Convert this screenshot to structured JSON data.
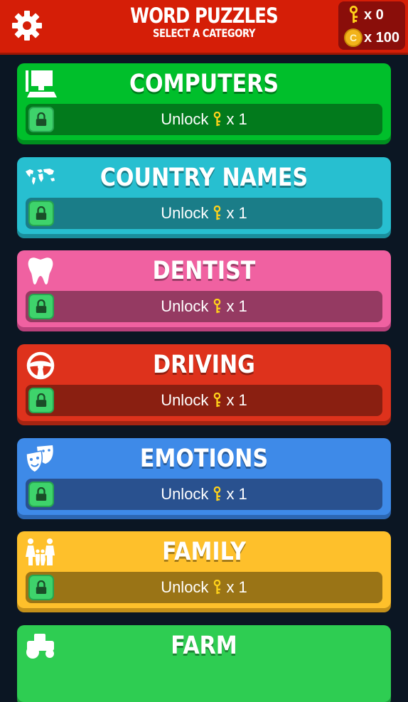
{
  "header": {
    "title": "WORD PUZZLES",
    "subtitle": "SELECT A CATEGORY",
    "settings_icon": "gear-icon",
    "keys_count": "x 0",
    "coins_count": "x 100",
    "coin_letter": "C",
    "bar_color": "#d51e07"
  },
  "unlock": {
    "label": "Unlock",
    "cost": "x 1",
    "key_color": "#ffd21a"
  },
  "categories": [
    {
      "title": "COMPUTERS",
      "icon": "computer-icon",
      "color": "#00bf2b",
      "shade": "#008f1f",
      "unlock_bg": "#027a1c"
    },
    {
      "title": "COUNTRY NAMES",
      "icon": "world-map-icon",
      "color": "#27bfd0",
      "shade": "#1a8e9c",
      "unlock_bg": "#1a7d88"
    },
    {
      "title": "DENTIST",
      "icon": "tooth-icon",
      "color": "#f061a1",
      "shade": "#b8407a",
      "unlock_bg": "#953a62"
    },
    {
      "title": "DRIVING",
      "icon": "steering-wheel-icon",
      "color": "#de321c",
      "shade": "#a52412",
      "unlock_bg": "#8a1f11"
    },
    {
      "title": "EMOTIONS",
      "icon": "theater-masks-icon",
      "color": "#3e8ae8",
      "shade": "#2c67b3",
      "unlock_bg": "#29518f"
    },
    {
      "title": "FAMILY",
      "icon": "family-icon",
      "color": "#fec02b",
      "shade": "#c4901a",
      "unlock_bg": "#9a7416"
    },
    {
      "title": "FARM",
      "icon": "tractor-icon",
      "color": "#2ecd52",
      "shade": "#1f9b3c",
      "unlock_bg": "#1d7c34"
    }
  ]
}
